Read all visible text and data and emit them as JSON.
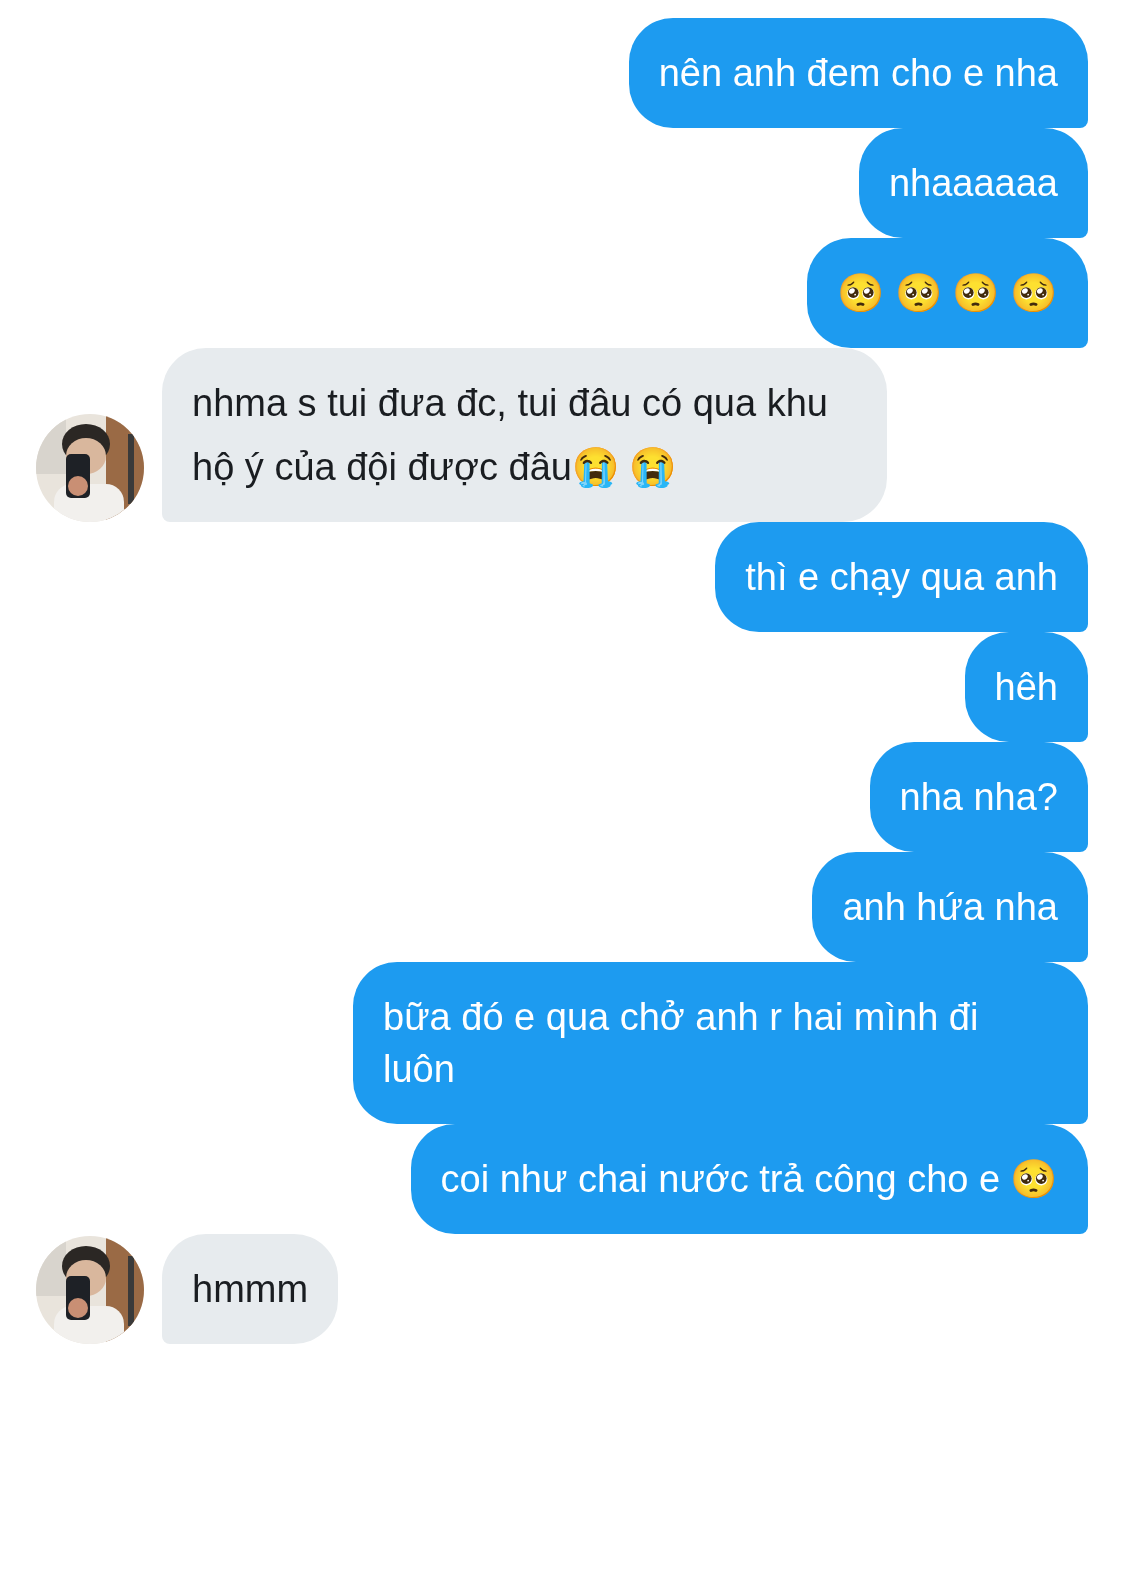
{
  "messages": [
    {
      "kind": "sent",
      "text": "nên anh đem cho e nha"
    },
    {
      "kind": "sent",
      "text": "nhaaaaaa"
    },
    {
      "kind": "sent",
      "text": "🥺 🥺 🥺 🥺"
    },
    {
      "kind": "received",
      "text": "nhma s tui đưa đc, tui đâu có qua khu hộ ý của đội được đâu😭 😭"
    },
    {
      "kind": "sent",
      "text": "thì e chạy qua anh"
    },
    {
      "kind": "sent",
      "text": "hêh"
    },
    {
      "kind": "sent",
      "text": "nha nha?"
    },
    {
      "kind": "sent",
      "text": "anh hứa nha"
    },
    {
      "kind": "sent",
      "text": "bữa đó e qua chở anh r hai mình đi luôn"
    },
    {
      "kind": "sent",
      "text": "coi như chai nước trả công cho e 🥺"
    },
    {
      "kind": "received",
      "text": "hmmm"
    }
  ]
}
